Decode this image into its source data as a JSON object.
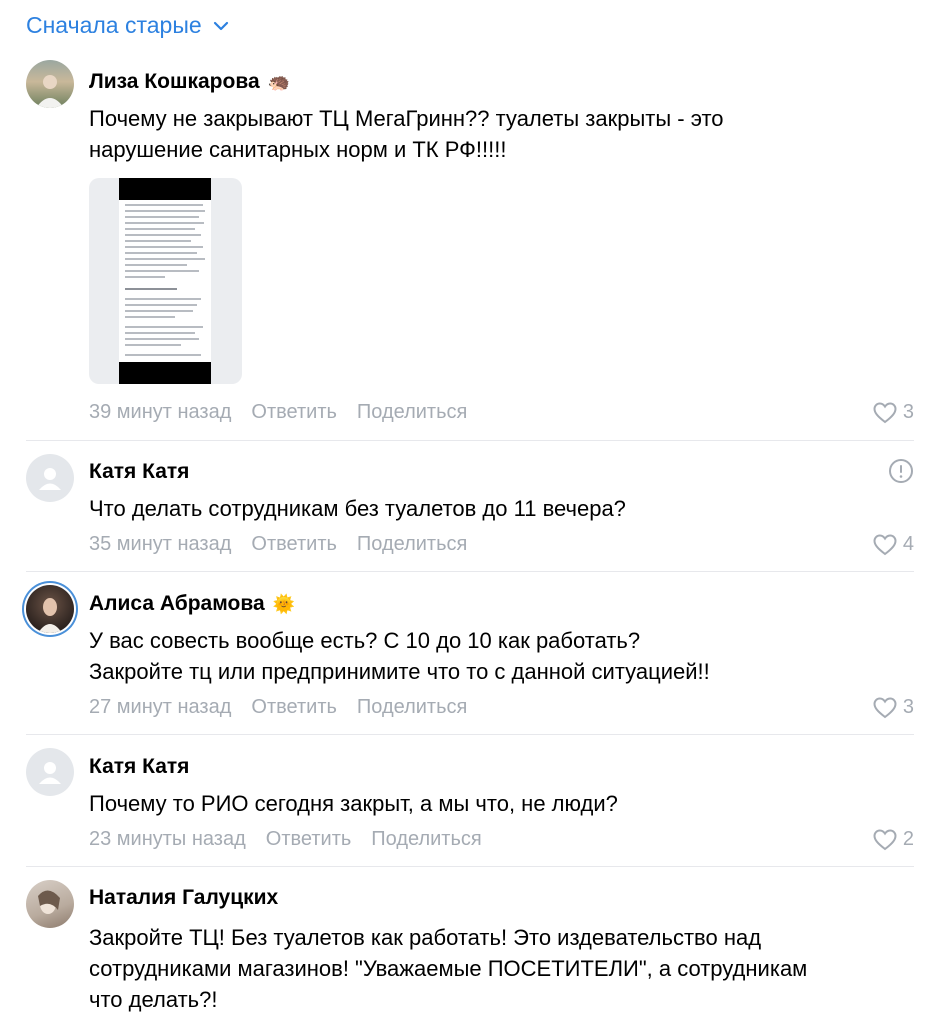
{
  "sort": {
    "label": "Сначала старые",
    "icon": "chevron-down-icon",
    "accent": "#2d81e0"
  },
  "comments": [
    {
      "author": "Лиза Кошкарова",
      "emoji": "🦔",
      "text": "Почему не закрывают ТЦ МегаГринн?? туалеты закрыты - это\nнарушение санитарных норм и ТК РФ!!!!!",
      "time": "39 минут назад",
      "reply": "Ответить",
      "share": "Поделиться",
      "likes": "3"
    },
    {
      "author": "Катя Катя",
      "emoji": "",
      "text": "Что делать сотрудникам без туалетов до 11 вечера?",
      "time": "35 минут назад",
      "reply": "Ответить",
      "share": "Поделиться",
      "likes": "4"
    },
    {
      "author": "Алиса Абрамова",
      "emoji": "🌞",
      "text": "У вас совесть вообще есть? С 10 до 10 как работать?\nЗакройте тц или предпринимите что то с данной ситуацией!!",
      "time": "27 минут назад",
      "reply": "Ответить",
      "share": "Поделиться",
      "likes": "3"
    },
    {
      "author": "Катя Катя",
      "emoji": "",
      "text": "Почему то РИО сегодня закрыт, а мы что, не люди?",
      "time": "23 минуты назад",
      "reply": "Ответить",
      "share": "Поделиться",
      "likes": "2"
    },
    {
      "author": "Наталия Галуцких",
      "emoji": "",
      "text": "Закройте ТЦ! Без туалетов как работать! Это издевательство над\nсотрудниками магазинов! \"Уважаемые ПОСЕТИТЕЛИ\", а сотрудникам\nчто делать?!"
    }
  ]
}
